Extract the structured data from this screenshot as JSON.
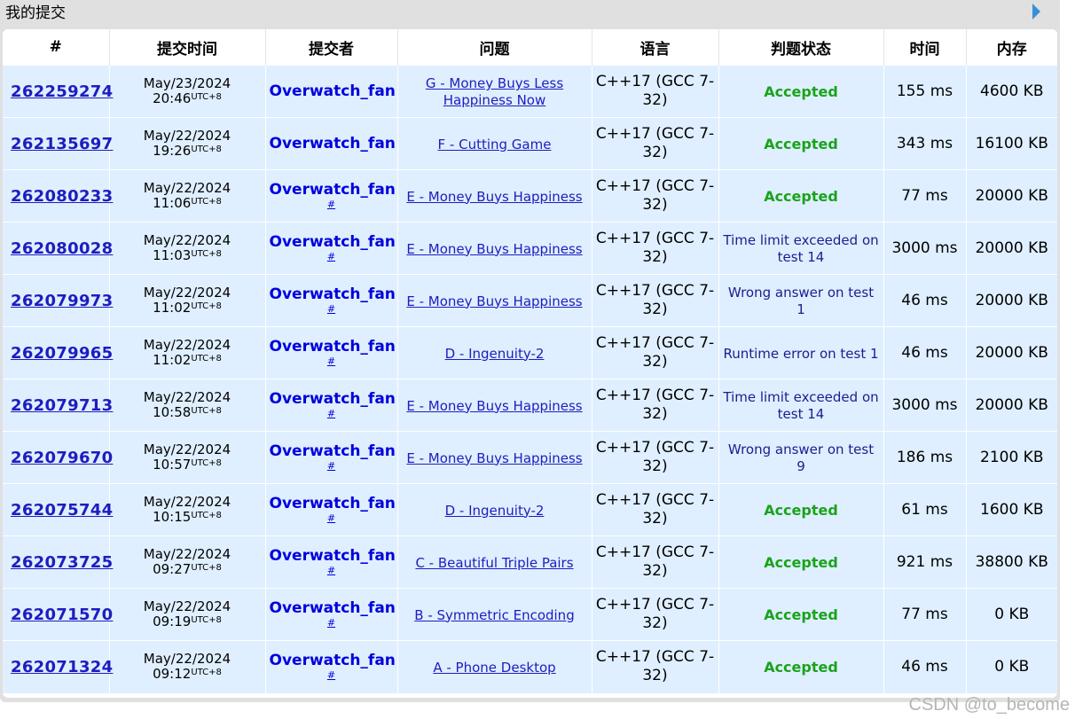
{
  "panel": {
    "title": "我的提交"
  },
  "table": {
    "headers": [
      "#",
      "提交时间",
      "提交者",
      "问题",
      "语言",
      "判题状态",
      "时间",
      "内存"
    ],
    "rows": [
      {
        "id": "262259274",
        "date": "May/23/2024",
        "time": "20:46",
        "tz": "UTC+8",
        "author": "Overwatch_fan",
        "author_link": "",
        "problem": "G - Money Buys Less Happiness Now",
        "lang": "C++17 (GCC 7-32)",
        "verdict": "Accepted",
        "accepted": true,
        "time_used": "155 ms",
        "memory": "4600 KB"
      },
      {
        "id": "262135697",
        "date": "May/22/2024",
        "time": "19:26",
        "tz": "UTC+8",
        "author": "Overwatch_fan",
        "author_link": "",
        "problem": "F - Cutting Game",
        "lang": "C++17 (GCC 7-32)",
        "verdict": "Accepted",
        "accepted": true,
        "time_used": "343 ms",
        "memory": "16100 KB"
      },
      {
        "id": "262080233",
        "date": "May/22/2024",
        "time": "11:06",
        "tz": "UTC+8",
        "author": "Overwatch_fan",
        "author_link": "#",
        "problem": "E - Money Buys Happiness",
        "lang": "C++17 (GCC 7-32)",
        "verdict": "Accepted",
        "accepted": true,
        "time_used": "77 ms",
        "memory": "20000 KB"
      },
      {
        "id": "262080028",
        "date": "May/22/2024",
        "time": "11:03",
        "tz": "UTC+8",
        "author": "Overwatch_fan",
        "author_link": "#",
        "problem": "E - Money Buys Happiness",
        "lang": "C++17 (GCC 7-32)",
        "verdict": "Time limit exceeded on test 14",
        "accepted": false,
        "time_used": "3000 ms",
        "memory": "20000 KB"
      },
      {
        "id": "262079973",
        "date": "May/22/2024",
        "time": "11:02",
        "tz": "UTC+8",
        "author": "Overwatch_fan",
        "author_link": "#",
        "problem": "E - Money Buys Happiness",
        "lang": "C++17 (GCC 7-32)",
        "verdict": "Wrong answer on test 1",
        "accepted": false,
        "time_used": "46 ms",
        "memory": "20000 KB"
      },
      {
        "id": "262079965",
        "date": "May/22/2024",
        "time": "11:02",
        "tz": "UTC+8",
        "author": "Overwatch_fan",
        "author_link": "#",
        "problem": "D - Ingenuity-2",
        "lang": "C++17 (GCC 7-32)",
        "verdict": "Runtime error on test 1",
        "accepted": false,
        "time_used": "46 ms",
        "memory": "20000 KB"
      },
      {
        "id": "262079713",
        "date": "May/22/2024",
        "time": "10:58",
        "tz": "UTC+8",
        "author": "Overwatch_fan",
        "author_link": "#",
        "problem": "E - Money Buys Happiness",
        "lang": "C++17 (GCC 7-32)",
        "verdict": "Time limit exceeded on test 14",
        "accepted": false,
        "time_used": "3000 ms",
        "memory": "20000 KB"
      },
      {
        "id": "262079670",
        "date": "May/22/2024",
        "time": "10:57",
        "tz": "UTC+8",
        "author": "Overwatch_fan",
        "author_link": "#",
        "problem": "E - Money Buys Happiness",
        "lang": "C++17 (GCC 7-32)",
        "verdict": "Wrong answer on test 9",
        "accepted": false,
        "time_used": "186 ms",
        "memory": "2100 KB"
      },
      {
        "id": "262075744",
        "date": "May/22/2024",
        "time": "10:15",
        "tz": "UTC+8",
        "author": "Overwatch_fan",
        "author_link": "#",
        "problem": "D - Ingenuity-2",
        "lang": "C++17 (GCC 7-32)",
        "verdict": "Accepted",
        "accepted": true,
        "time_used": "61 ms",
        "memory": "1600 KB"
      },
      {
        "id": "262073725",
        "date": "May/22/2024",
        "time": "09:27",
        "tz": "UTC+8",
        "author": "Overwatch_fan",
        "author_link": "#",
        "problem": "C - Beautiful Triple Pairs",
        "lang": "C++17 (GCC 7-32)",
        "verdict": "Accepted",
        "accepted": true,
        "time_used": "921 ms",
        "memory": "38800 KB"
      },
      {
        "id": "262071570",
        "date": "May/22/2024",
        "time": "09:19",
        "tz": "UTC+8",
        "author": "Overwatch_fan",
        "author_link": "#",
        "problem": "B - Symmetric Encoding",
        "lang": "C++17 (GCC 7-32)",
        "verdict": "Accepted",
        "accepted": true,
        "time_used": "77 ms",
        "memory": "0 KB"
      },
      {
        "id": "262071324",
        "date": "May/22/2024",
        "time": "09:12",
        "tz": "UTC+8",
        "author": "Overwatch_fan",
        "author_link": "#",
        "problem": "A - Phone Desktop",
        "lang": "C++17 (GCC 7-32)",
        "verdict": "Accepted",
        "accepted": true,
        "time_used": "46 ms",
        "memory": "0 KB"
      }
    ]
  },
  "watermark": "CSDN @to_become",
  "colors": {
    "accepted": "#1aa31a",
    "verdict_other": "#1d1d8f",
    "link": "#1d1dbf",
    "author": "#0000dd",
    "row_bg": "#dfefff",
    "panel_bg": "#e0e0e0"
  },
  "icons": {
    "next": "triangle-right-icon"
  }
}
